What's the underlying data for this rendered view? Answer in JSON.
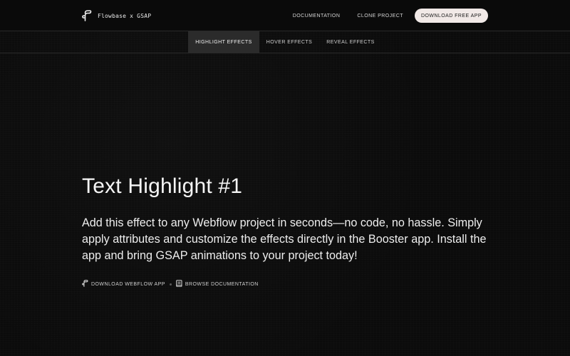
{
  "header": {
    "brand_text": "Flowbase x GSAP",
    "brand_icon": "flowbase-logo-icon",
    "nav": [
      {
        "label": "DOCUMENTATION"
      },
      {
        "label": "CLONE PROJECT"
      }
    ],
    "cta_label": "DOWNLOAD FREE APP"
  },
  "tabs": [
    {
      "label": "HIGHLIGHT EFFECTS",
      "active": true
    },
    {
      "label": "HOVER EFFECTS",
      "active": false
    },
    {
      "label": "REVEAL EFFECTS",
      "active": false
    }
  ],
  "hero": {
    "title": "Text Highlight #1",
    "body": "Add this effect to any Webflow project in seconds—no code, no hassle. Simply apply attributes and customize the effects directly in the Booster app. Install the app and bring GSAP animations to your project today!",
    "links": [
      {
        "label": "DOWNLOAD WEBFLOW APP",
        "icon": "flowbase-logo-icon"
      },
      {
        "label": "BROWSE DOCUMENTATION",
        "icon": "book-icon"
      }
    ]
  },
  "colors": {
    "background": "#0b0b0b",
    "text": "#f2f2f2",
    "cta_background": "#f1e9e7",
    "active_tab_background": "#2b2b2b",
    "divider": "#2a2a2a"
  }
}
